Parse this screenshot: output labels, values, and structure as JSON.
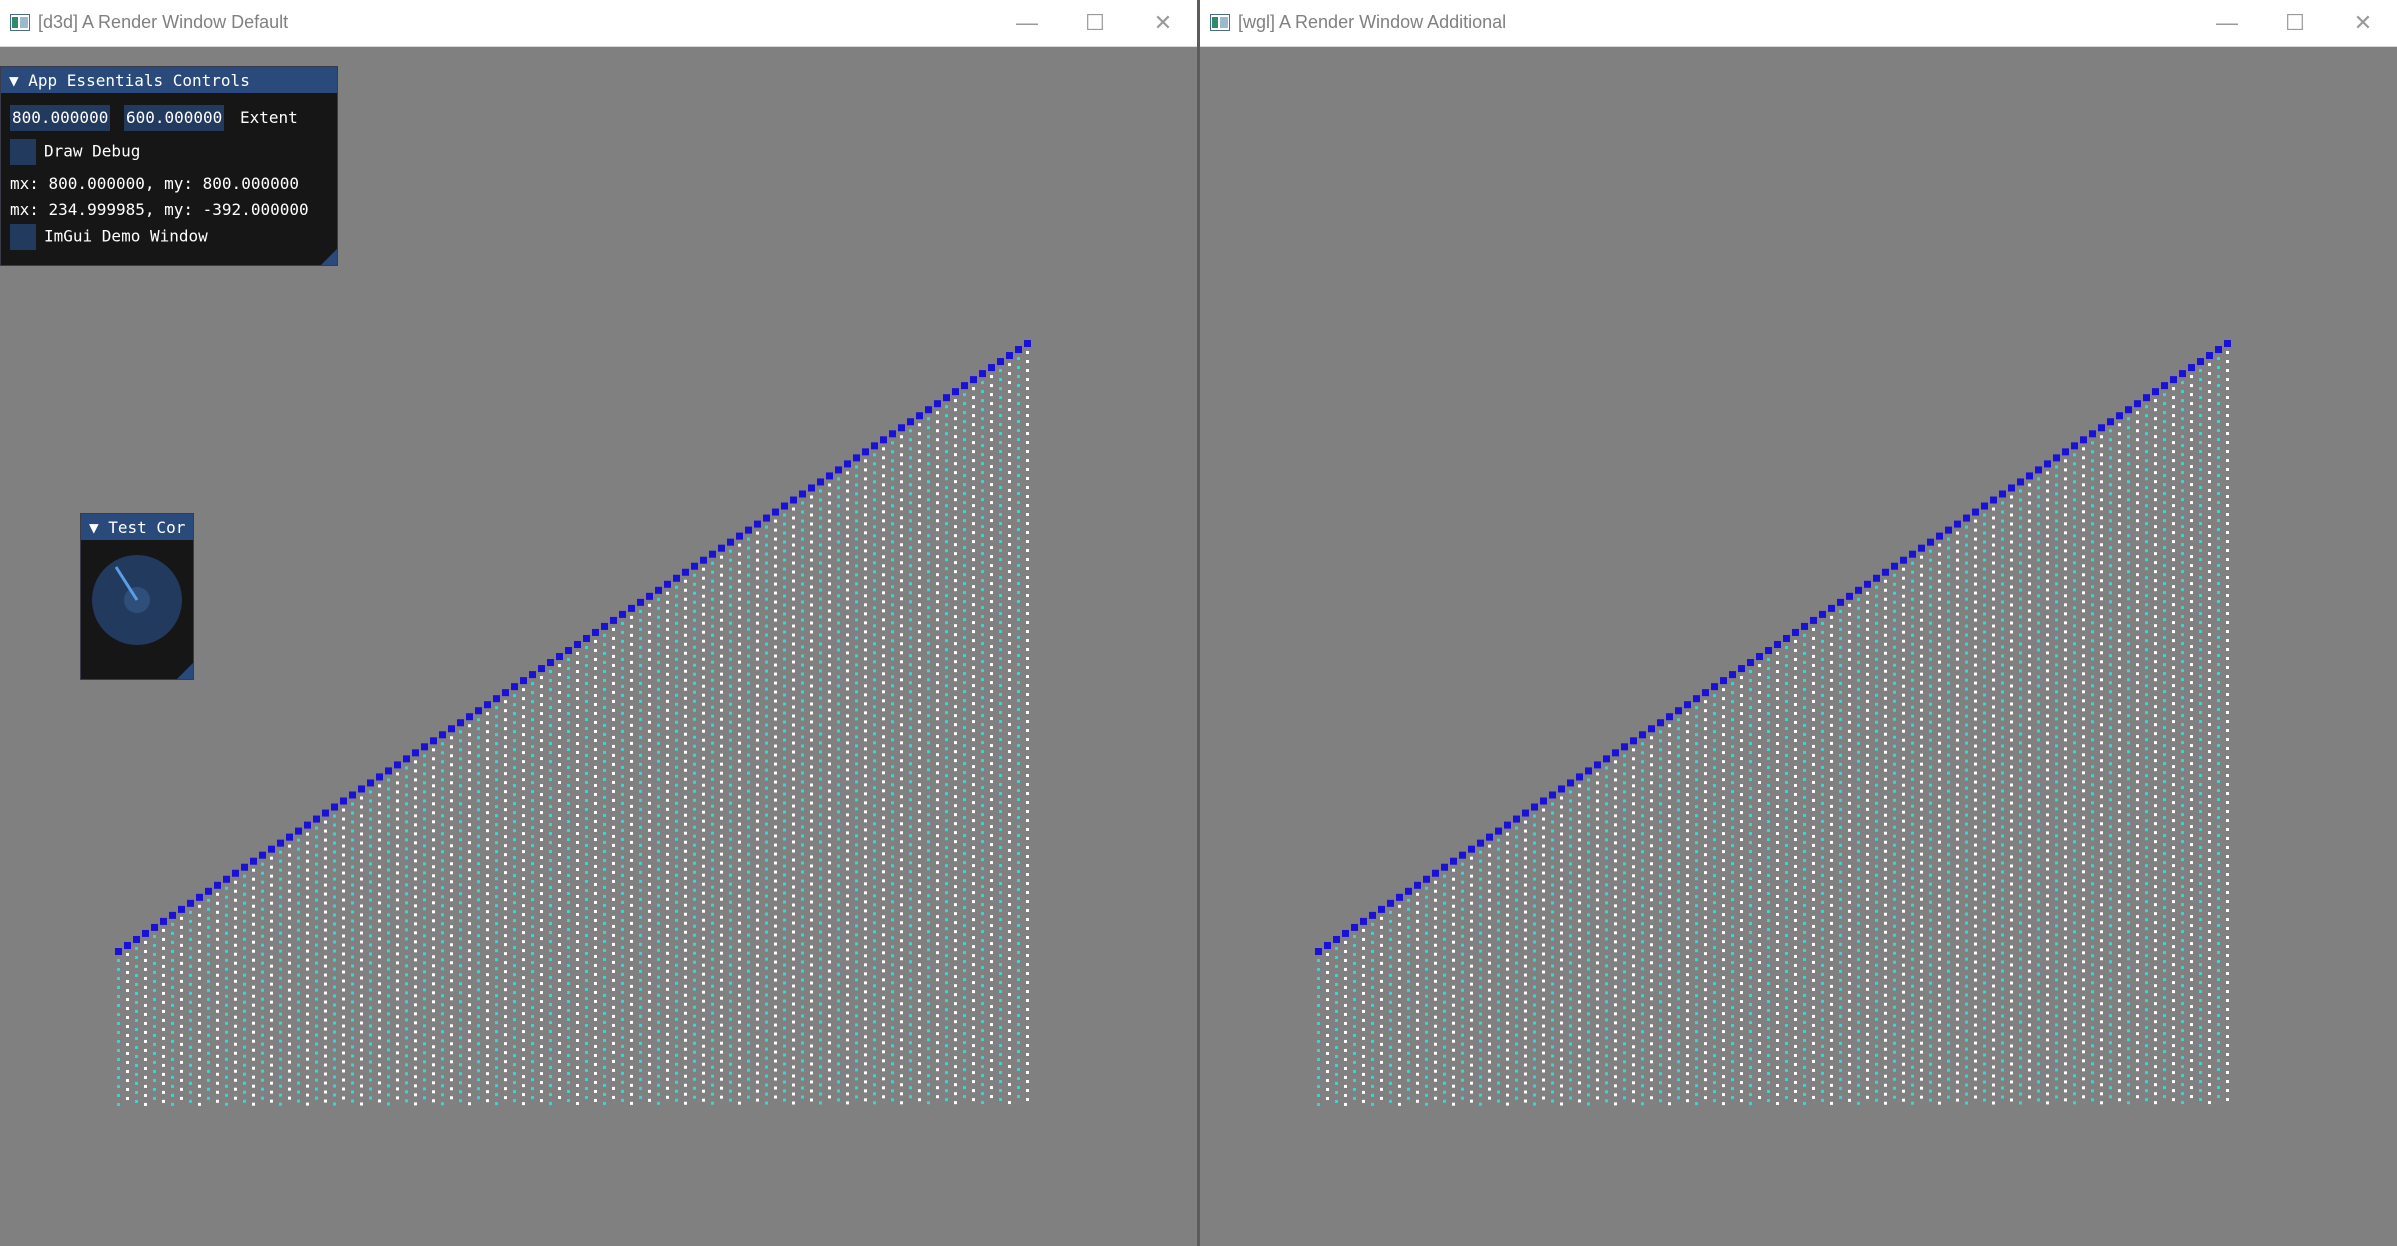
{
  "left_window": {
    "title": "[d3d] A Render Window Default"
  },
  "right_window": {
    "title": "[wgl] A Render Window Additional"
  },
  "window_controls": {
    "minimize_glyph": "—",
    "maximize_glyph": "☐",
    "close_glyph": "✕"
  },
  "app_controls": {
    "title": "▼ App Essentials Controls",
    "extent_x": "800.000000",
    "extent_y": "600.000000",
    "extent_label": "Extent",
    "draw_debug_label": "Draw Debug",
    "line1": "mx: 800.000000, my: 800.000000",
    "line2": "mx: 234.999985, my: -392.000000",
    "demo_window_label": "ImGui Demo Window"
  },
  "test_panel": {
    "title": "▼ Test Cor"
  },
  "colors": {
    "background": "#808080",
    "edge_dot": "#1a10d8",
    "fill_dot": "#ffffff",
    "fill_dot_alt": "#3ad4d4",
    "imgui_header": "#294a7a",
    "imgui_frame": "#223a5e"
  },
  "icons": {
    "app_icon": "window-app-icon",
    "knob": "knob-dial-icon"
  }
}
